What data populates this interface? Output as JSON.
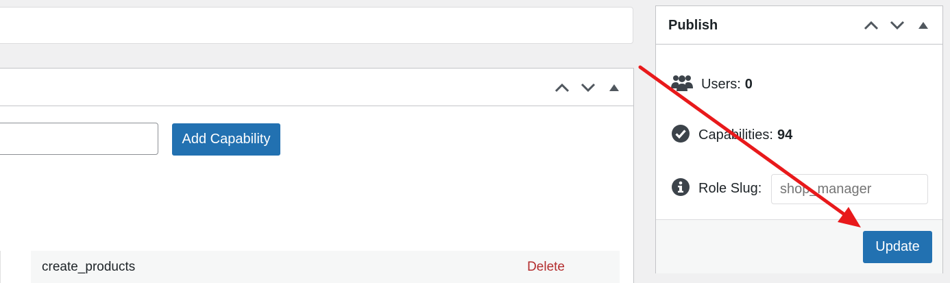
{
  "caps_panel": {
    "add_button_label": "Add Capability",
    "rows": [
      {
        "capability": "create_products",
        "action": "Delete"
      }
    ]
  },
  "publish": {
    "title": "Publish",
    "users_label": "Users:",
    "users_value": "0",
    "capabilities_label": "Capabilities:",
    "capabilities_value": "94",
    "role_slug_label": "Role Slug:",
    "role_slug_placeholder": "shop_manager",
    "update_label": "Update"
  },
  "colors": {
    "primary": "#2271b1",
    "delete": "#b32d2e",
    "annotation_arrow": "#e8191b"
  },
  "icons": [
    "chevron-up-icon",
    "chevron-down-icon",
    "triangle-up-icon",
    "users-icon",
    "check-circle-icon",
    "info-icon"
  ]
}
